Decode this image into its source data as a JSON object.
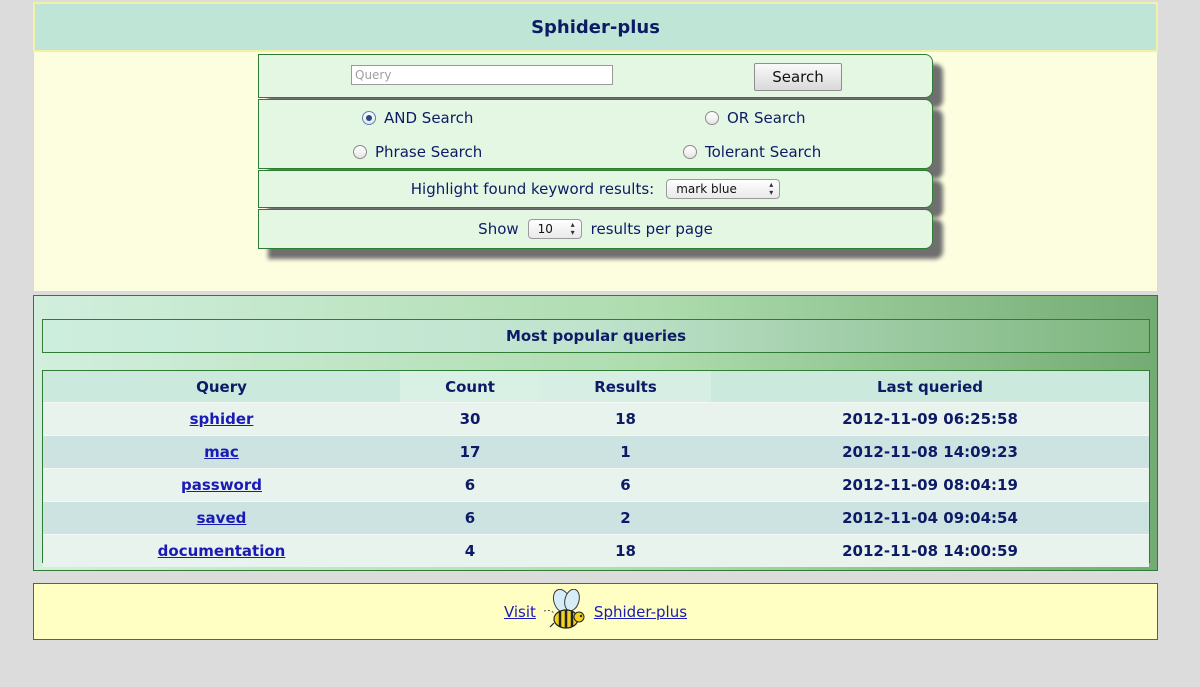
{
  "header": {
    "title": "Sphider-plus"
  },
  "search": {
    "placeholder": "Query",
    "button_label": "Search",
    "options": [
      {
        "label": "AND Search",
        "selected": true
      },
      {
        "label": "OR Search",
        "selected": false
      },
      {
        "label": "Phrase Search",
        "selected": false
      },
      {
        "label": "Tolerant Search",
        "selected": false
      }
    ],
    "highlight_label": "Highlight found keyword results:",
    "highlight_value": "mark blue",
    "show_label": "Show",
    "show_value": "10",
    "per_page_label": "results per page"
  },
  "popular": {
    "title": "Most popular queries",
    "columns": [
      "Query",
      "Count",
      "Results",
      "Last queried"
    ],
    "rows": [
      {
        "query": "sphider",
        "count": "30",
        "results": "18",
        "last": "2012-11-09 06:25:58"
      },
      {
        "query": "mac",
        "count": "17",
        "results": "1",
        "last": "2012-11-08 14:09:23"
      },
      {
        "query": "password",
        "count": "6",
        "results": "6",
        "last": "2012-11-09 08:04:19"
      },
      {
        "query": "saved",
        "count": "6",
        "results": "2",
        "last": "2012-11-04 09:04:54"
      },
      {
        "query": "documentation",
        "count": "4",
        "results": "18",
        "last": "2012-11-08 14:00:59"
      }
    ]
  },
  "footer": {
    "visit_label": "Visit",
    "link_label": "Sphider-plus"
  },
  "colors": {
    "header_bg": "#bfe5d6",
    "panel_bg": "#e4f7e2",
    "link": "#1a1ab5",
    "text": "#0d1b66",
    "footer_bg": "#ffffc4"
  }
}
